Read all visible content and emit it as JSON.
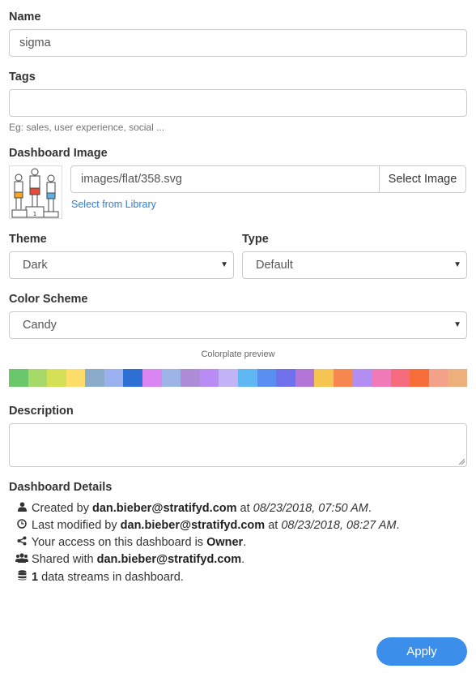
{
  "name": {
    "label": "Name",
    "value": "sigma"
  },
  "tags": {
    "label": "Tags",
    "value": "",
    "hint": "Eg: sales, user experience, social ..."
  },
  "dashboard_image": {
    "label": "Dashboard Image",
    "path": "images/flat/358.svg",
    "select_button": "Select Image",
    "library_link": "Select from Library",
    "icon": "podium-people-illustration"
  },
  "theme": {
    "label": "Theme",
    "value": "Dark"
  },
  "type": {
    "label": "Type",
    "value": "Default"
  },
  "color_scheme": {
    "label": "Color Scheme",
    "value": "Candy",
    "preview_title": "Colorplate preview",
    "colors": [
      "#6cc66c",
      "#a6d96a",
      "#d4e157",
      "#ffdd6b",
      "#8aabc9",
      "#9bb0ee",
      "#2e6fd3",
      "#d986f2",
      "#9db5e6",
      "#ad8bd6",
      "#b98bf5",
      "#c2b3f7",
      "#5fb8f1",
      "#5a8ef0",
      "#6e70ec",
      "#b476d6",
      "#f6c451",
      "#f6884f",
      "#b28ef2",
      "#f07ab8",
      "#f66b7e",
      "#f86e3b",
      "#f4a18a",
      "#edb07c"
    ]
  },
  "description": {
    "label": "Description",
    "value": ""
  },
  "details": {
    "label": "Dashboard Details",
    "created_prefix": "Created by",
    "created_by": "dan.bieber@stratifyd.com",
    "created_at_prefix": "at",
    "created_at": "08/23/2018, 07:50 AM",
    "modified_prefix": "Last modified by",
    "modified_by": "dan.bieber@stratifyd.com",
    "modified_at_prefix": "at",
    "modified_at": "08/23/2018, 08:27 AM",
    "access_prefix": "Your access on this dashboard is",
    "access": "Owner",
    "shared_prefix": "Shared with",
    "shared_with": "dan.bieber@stratifyd.com",
    "streams_count": "1",
    "streams_suffix": "data streams in dashboard."
  },
  "apply_button": "Apply"
}
